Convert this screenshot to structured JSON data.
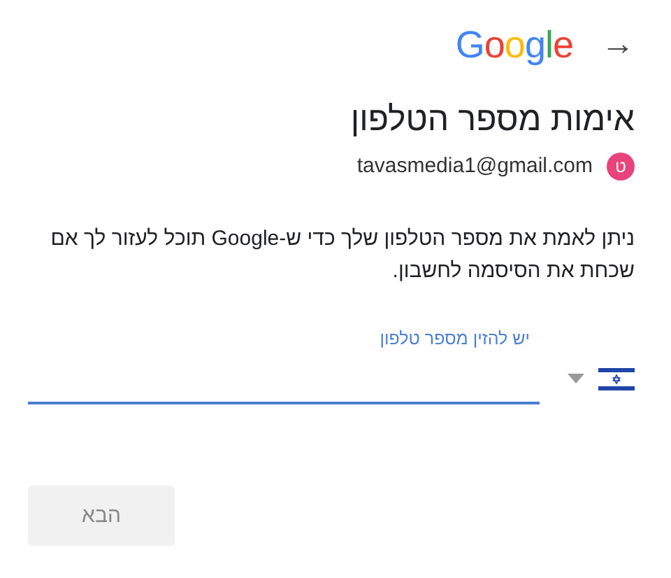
{
  "header": {
    "logo": "Google",
    "next_arrow": "→"
  },
  "title": "אימות מספר הטלפון",
  "account": {
    "avatar_letter": "ט",
    "email": "tavasmedia1@gmail.com"
  },
  "description": "ניתן לאמת את מספר הטלפון שלך כדי ש-Google תוכל לעזור לך אם שכחת את הסיסמה לחשבון.",
  "phone_field": {
    "label": "יש להזין מספר טלפון",
    "focused": true
  },
  "next_button": {
    "label": "הבא",
    "disabled": true
  }
}
